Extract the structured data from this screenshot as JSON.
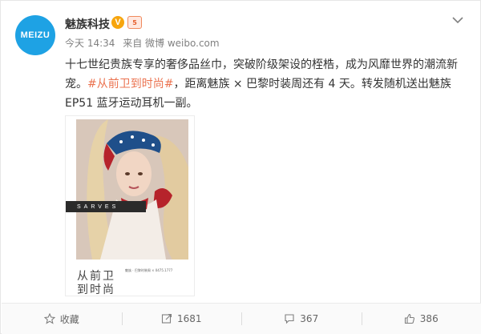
{
  "user": {
    "avatar_text": "MEIZU",
    "name": "魅族科技",
    "verified_badge": "V",
    "rank_badge": "5"
  },
  "meta": {
    "time": "今天 14:34",
    "source": "来自 微博 weibo.com"
  },
  "post": {
    "text_before": "十七世纪贵族专享的奢侈品丝巾，突破阶级架设的桎梏，成为风靡世界的潮流新宠。",
    "topic": "#从前卫到时尚#",
    "text_after": "，距离魅族 × 巴黎时装周还有 4 天。转发随机送出魅族 EP51 蓝牙运动耳机一副。"
  },
  "image": {
    "band_text": "SARVES",
    "title_line1": "从前卫",
    "title_line2": "到时尚",
    "small_text": "魅族 · 巴黎时装周 × 0475.1777"
  },
  "actions": [
    {
      "label": "收藏",
      "icon": "star-icon"
    },
    {
      "label": "1681",
      "icon": "share-icon"
    },
    {
      "label": "367",
      "icon": "comment-icon"
    },
    {
      "label": "386",
      "icon": "thumbs-up-icon"
    }
  ],
  "colors": {
    "avatar_bg": "#1ea2e4",
    "topic": "#eb7350",
    "verified": "#f7a50d"
  }
}
